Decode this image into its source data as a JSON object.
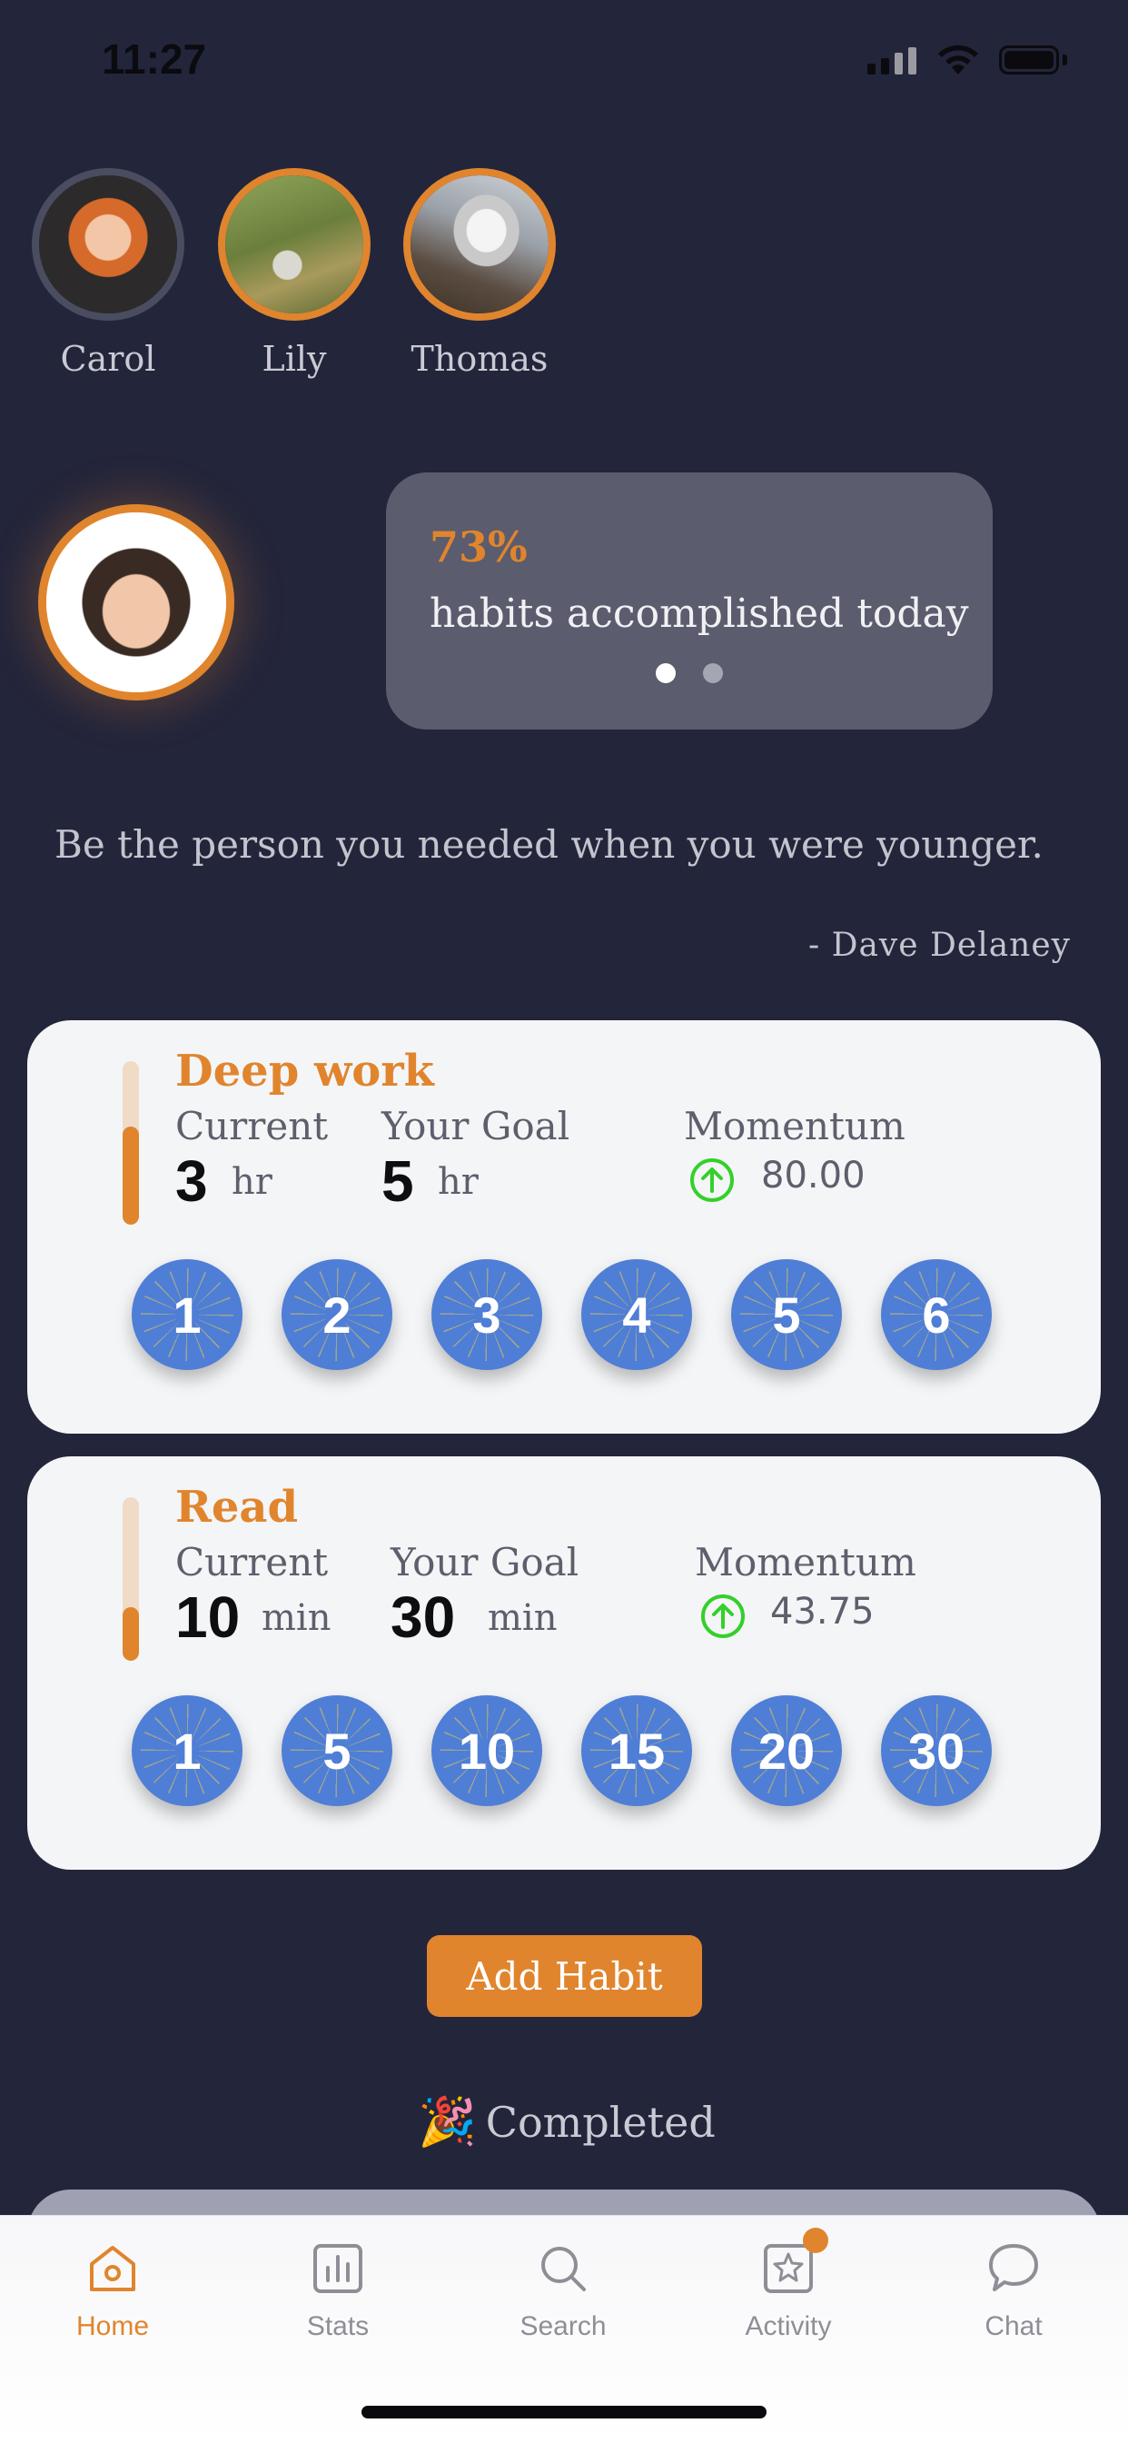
{
  "status_bar": {
    "time": "11:27"
  },
  "friends": [
    {
      "name": "Carol"
    },
    {
      "name": "Lily"
    },
    {
      "name": "Thomas"
    }
  ],
  "progress": {
    "percent_text": "73%",
    "label": "habits accomplished today"
  },
  "quote": {
    "text": "Be the person you needed when you were younger.",
    "author": "- Dave Delaney"
  },
  "habits": [
    {
      "title": "Deep work",
      "current_label": "Current",
      "current_value": "3",
      "current_unit": "hr",
      "goal_label": "Your Goal",
      "goal_value": "5",
      "goal_unit": "hr",
      "momentum_label": "Momentum",
      "momentum_value": "80.00",
      "progress_fraction": 0.6,
      "chips": [
        "1",
        "2",
        "3",
        "4",
        "5",
        "6"
      ]
    },
    {
      "title": "Read",
      "current_label": "Current",
      "current_value": "10",
      "current_unit": "min",
      "goal_label": "Your Goal",
      "goal_value": "30",
      "goal_unit": "min",
      "momentum_label": "Momentum",
      "momentum_value": "43.75",
      "progress_fraction": 0.33,
      "chips": [
        "1",
        "5",
        "10",
        "15",
        "20",
        "30"
      ]
    }
  ],
  "add_habit_label": "Add Habit",
  "completed_label": "Completed",
  "tabs": [
    {
      "label": "Home",
      "icon": "home-icon"
    },
    {
      "label": "Stats",
      "icon": "stats-icon"
    },
    {
      "label": "Search",
      "icon": "search-icon"
    },
    {
      "label": "Activity",
      "icon": "activity-icon"
    },
    {
      "label": "Chat",
      "icon": "chat-icon"
    }
  ],
  "colors": {
    "accent": "#e0852d",
    "background": "#23253b",
    "chip": "#4f7ed6",
    "momentum_up": "#34d02a"
  }
}
